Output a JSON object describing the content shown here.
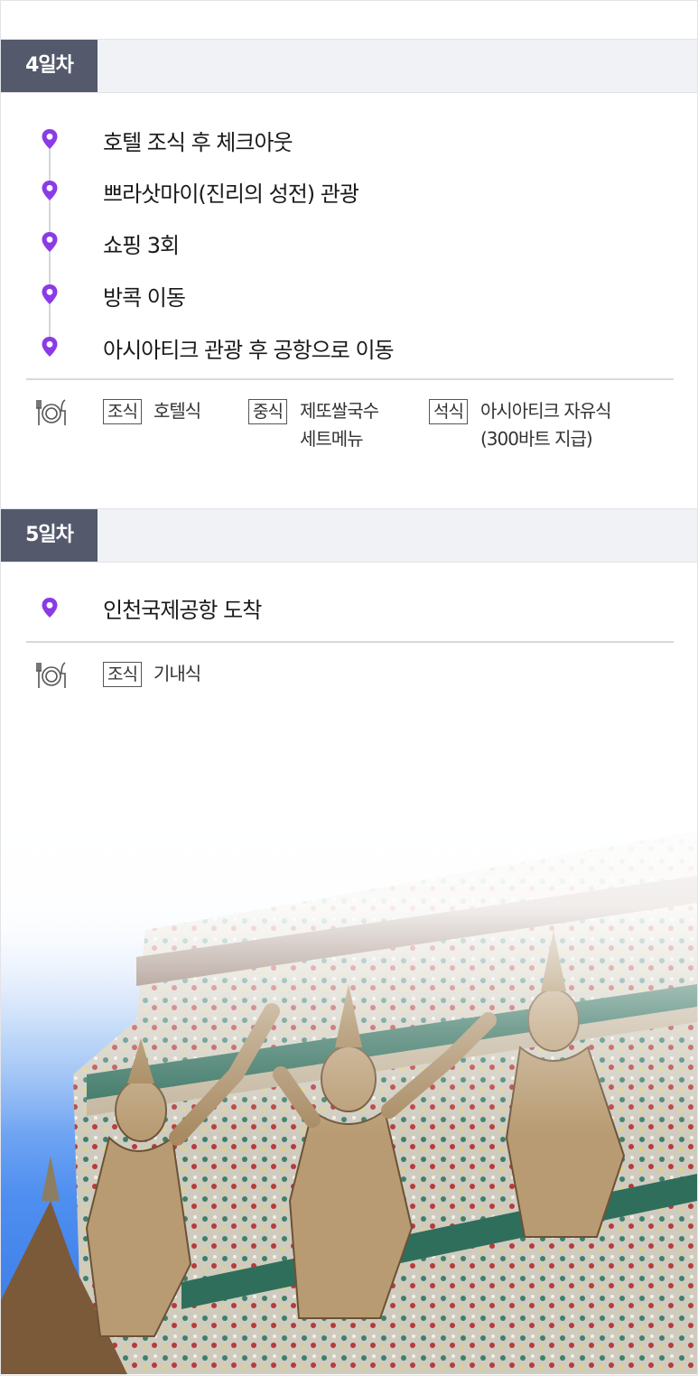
{
  "days": [
    {
      "label": "4일차",
      "items": [
        "호텔 조식 후 체크아웃",
        "쁘라삿마이(진리의 성전) 관광",
        "쇼핑 3회",
        "방콕 이동",
        "아시아티크 관광 후 공항으로 이동"
      ],
      "meals": {
        "breakfast": {
          "tag": "조식",
          "value": "호텔식"
        },
        "lunch": {
          "tag": "중식",
          "line1": "제또쌀국수",
          "line2": "세트메뉴"
        },
        "dinner": {
          "tag": "석식",
          "line1": "아시아티크 자유식",
          "line2": "(300바트 지급)"
        }
      }
    },
    {
      "label": "5일차",
      "items": [
        "인천국제공항 도착"
      ],
      "meals": {
        "breakfast": {
          "tag": "조식",
          "value": "기내식"
        }
      }
    }
  ],
  "colors": {
    "badge": "#545a6c",
    "pin": "#8a3be6",
    "header_bg": "#f1f2f6"
  },
  "icons": {
    "pin": "map-pin-icon",
    "meal": "fork-plate-knife-icon"
  },
  "photo": {
    "subject": "Wat Arun temple demon guardian statues against blue sky"
  }
}
